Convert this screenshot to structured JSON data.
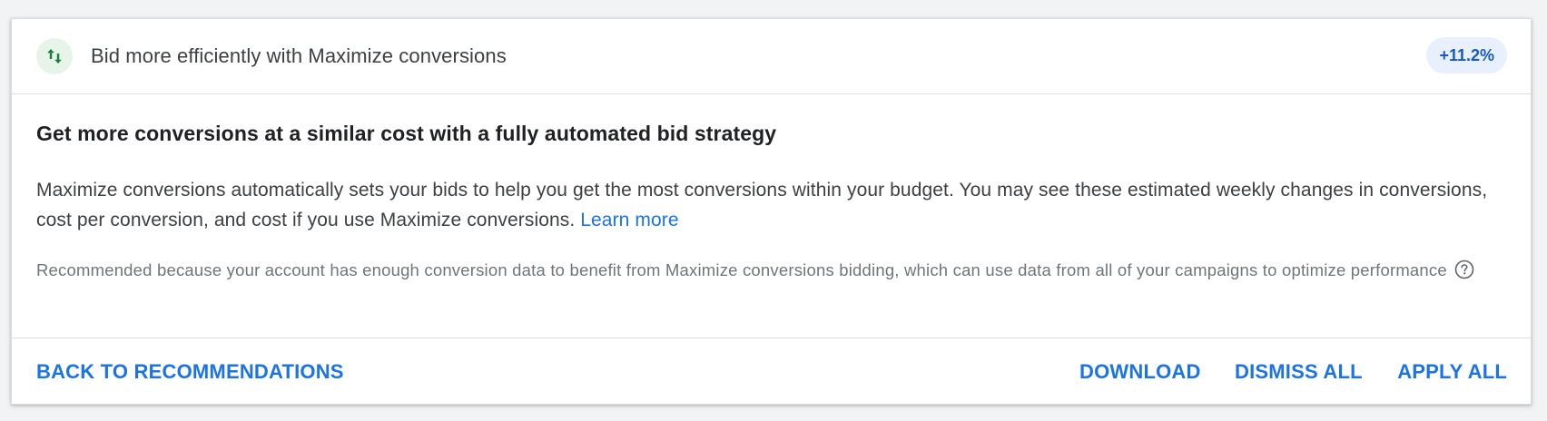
{
  "header": {
    "icon": "swap-vert-arrows-icon",
    "title": "Bid more efficiently with Maximize conversions",
    "uplift_badge": "+11.2%"
  },
  "main": {
    "headline": "Get more conversions at a similar cost with a fully automated bid strategy",
    "description": "Maximize conversions automatically sets your bids to help you get the most conversions within your budget. You may see these estimated weekly changes in conversions, cost per conversion, and cost if you use Maximize conversions.",
    "learn_more_label": "Learn more",
    "reason": "Recommended because your account has enough conversion data to benefit from Maximize conversions bidding, which can use data from all of your campaigns to optimize performance",
    "help_icon": "help-outline-icon"
  },
  "footer": {
    "back_label": "BACK TO RECOMMENDATIONS",
    "download_label": "DOWNLOAD",
    "dismiss_label": "DISMISS ALL",
    "apply_label": "APPLY ALL"
  },
  "colors": {
    "accent": "#1a73e8",
    "icon_bg": "#e6f4ea",
    "icon_fg": "#188038",
    "badge_bg": "#e8f0fe",
    "badge_fg": "#185abc"
  }
}
